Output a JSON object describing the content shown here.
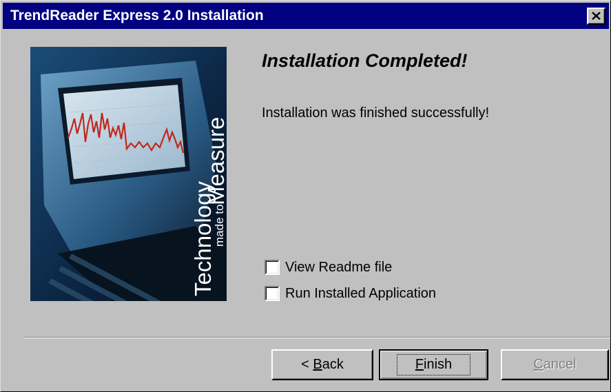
{
  "window": {
    "title": "TrendReader Express 2.0 Installation"
  },
  "banner": {
    "line1": "Technology",
    "line2": "made to",
    "line3": "Measure"
  },
  "content": {
    "heading": "Installation Completed!",
    "message": "Installation was finished successfully!"
  },
  "options": [
    {
      "label": "View Readme file",
      "checked": false
    },
    {
      "label": "Run Installed Application",
      "checked": false
    }
  ],
  "buttons": {
    "back": {
      "prefix": "< ",
      "accel": "B",
      "rest": "ack"
    },
    "finish": {
      "accel": "F",
      "rest": "inish"
    },
    "cancel": {
      "accel": "C",
      "rest": "ancel",
      "disabled": true
    }
  },
  "colors": {
    "titlebar": "#000080",
    "face": "#c0c0c0"
  }
}
